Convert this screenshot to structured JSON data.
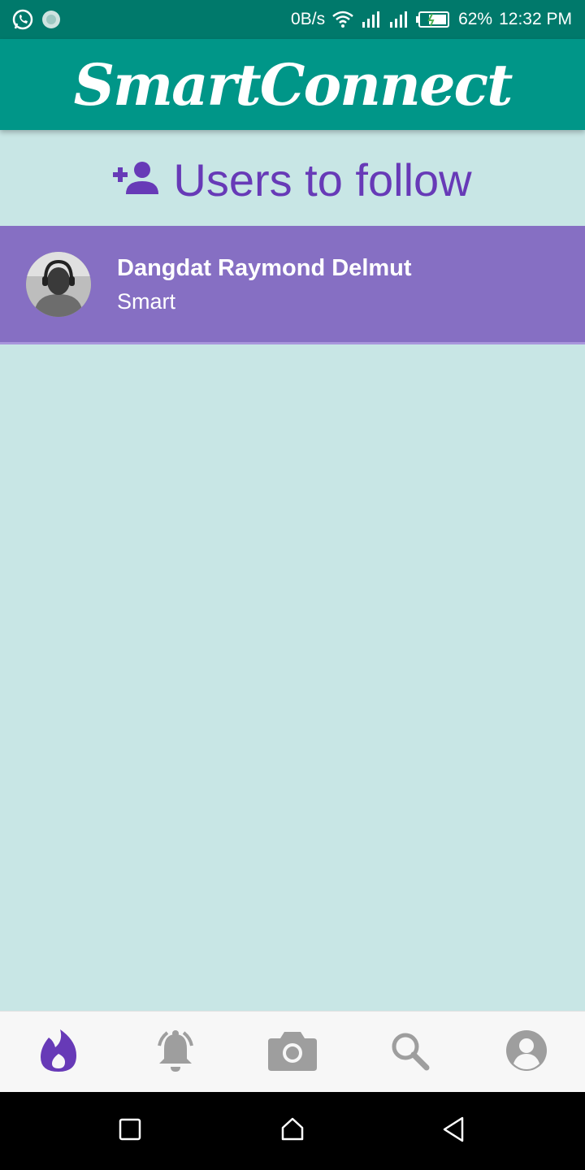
{
  "status_bar": {
    "net_speed": "0B/s",
    "battery_percent": "62%",
    "time": "12:32 PM",
    "icons": [
      "whatsapp-icon",
      "sync-icon",
      "wifi-icon",
      "signal-icon",
      "signal-icon",
      "battery-icon"
    ]
  },
  "app_bar": {
    "title": "SmartConnect",
    "color": "#009688"
  },
  "section": {
    "icon": "add-person-icon",
    "title": "Users to follow",
    "color": "#673ab7"
  },
  "users": [
    {
      "name": "Dangdat Raymond Delmut",
      "subtitle": "Smart"
    }
  ],
  "bottom_nav": {
    "items": [
      {
        "icon": "flame-icon",
        "active": true
      },
      {
        "icon": "bell-icon",
        "active": false
      },
      {
        "icon": "camera-icon",
        "active": false
      },
      {
        "icon": "search-icon",
        "active": false
      },
      {
        "icon": "account-icon",
        "active": false
      }
    ],
    "active_color": "#673ab7",
    "inactive_color": "#9e9e9e"
  },
  "system_nav": {
    "buttons": [
      "recents-icon",
      "home-icon",
      "back-icon"
    ]
  }
}
